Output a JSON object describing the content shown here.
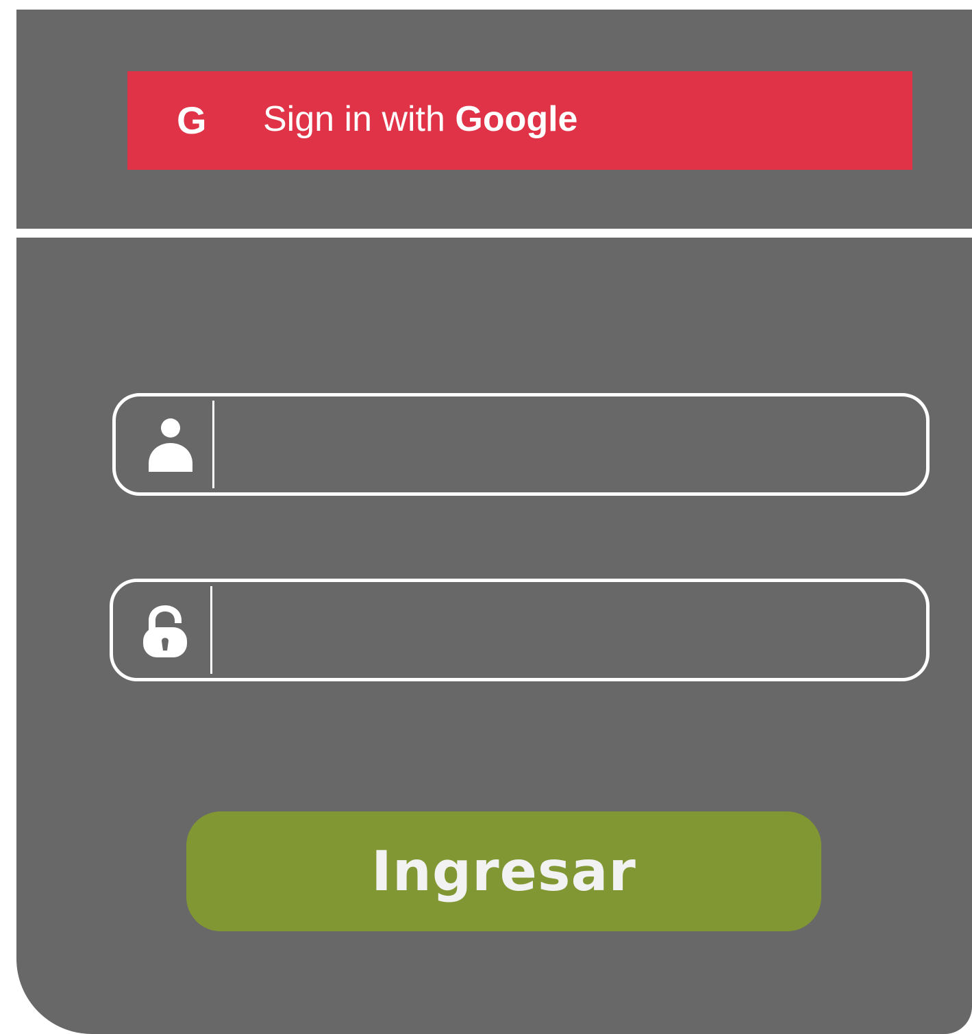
{
  "google_signin": {
    "icon_letter": "G",
    "label_prefix": "Sign in with ",
    "label_brand": "Google",
    "color": "#e03347"
  },
  "login_form": {
    "username_field": {
      "icon": "user-icon",
      "value": "",
      "placeholder": ""
    },
    "password_field": {
      "icon": "lock-icon",
      "value": "",
      "placeholder": ""
    },
    "submit_label": "Ingresar",
    "submit_color": "#819733"
  },
  "colors": {
    "panel_background": "#686868",
    "field_border": "#ffffff"
  }
}
